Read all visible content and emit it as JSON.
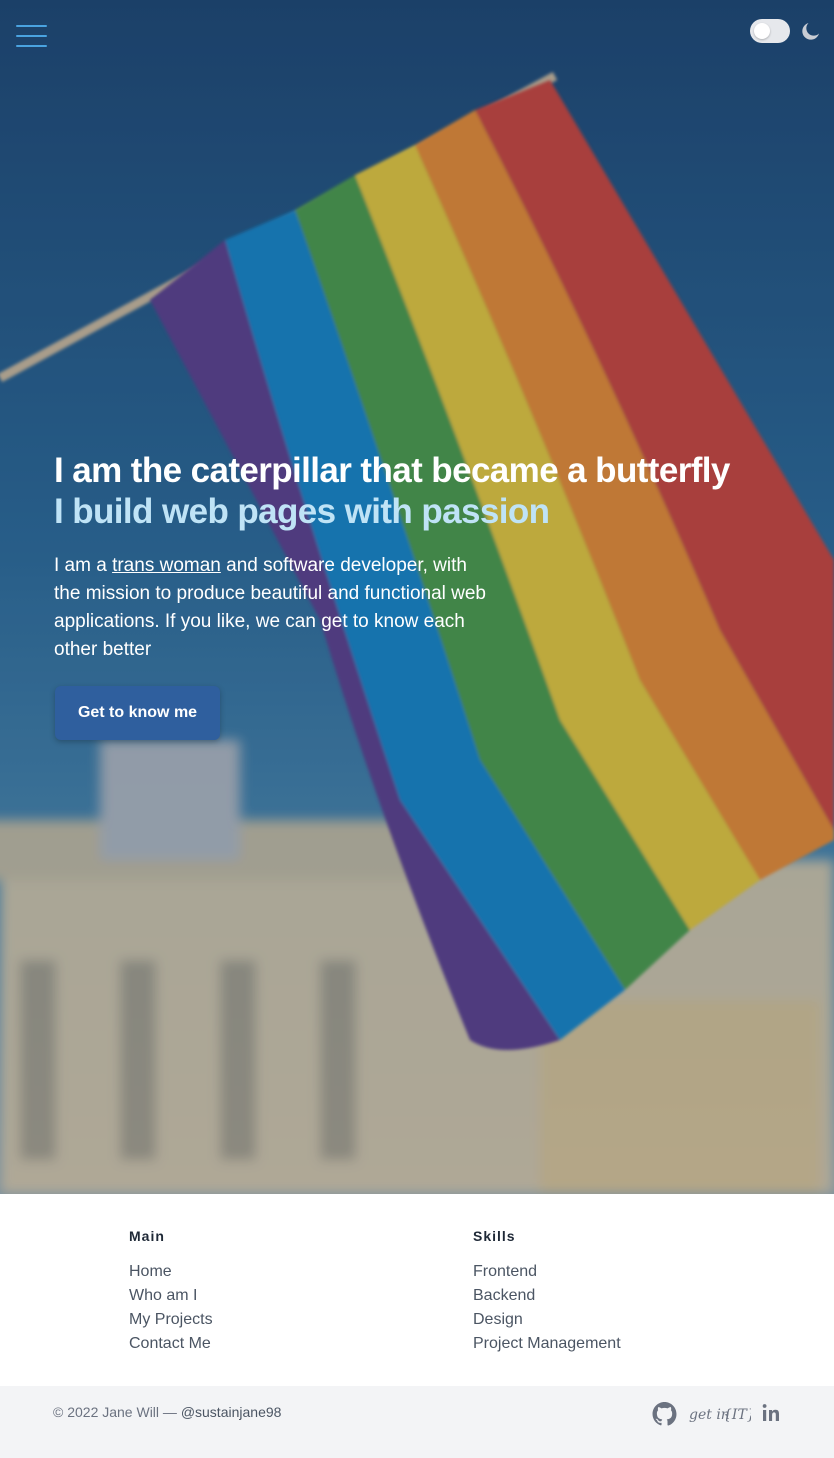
{
  "header": {
    "menu_icon": "hamburger-menu-icon",
    "theme_toggle_icon": "moon-icon",
    "theme_toggle_state": "off"
  },
  "hero": {
    "headline": "I am the caterpillar that became a butterfly",
    "headline_accent": "I build web pages with passion",
    "intro_before": "I am a ",
    "intro_link": "trans woman",
    "intro_after": " and software developer, with the mission to produce beautiful and functional web applications. If you like, we can get to know each other better",
    "cta_label": "Get to know me",
    "colors": {
      "accent_text": "#bfe3f6",
      "cta_bg": "#2f5f9e",
      "menu_icon": "#4aa3e0"
    }
  },
  "footer": {
    "main": {
      "title": "Main",
      "links": [
        "Home",
        "Who am I",
        "My Projects",
        "Contact Me"
      ]
    },
    "skills": {
      "title": "Skills",
      "links": [
        "Frontend",
        "Backend",
        "Design",
        "Project Management"
      ]
    },
    "copyright_prefix": "© 2022 Jane Will — ",
    "handle": "@sustainjane98",
    "social": {
      "getin_text": "get in",
      "getin_brace_text": "{IT}",
      "icons": [
        "github-icon",
        "getin-it-icon",
        "linkedin-icon"
      ]
    }
  }
}
